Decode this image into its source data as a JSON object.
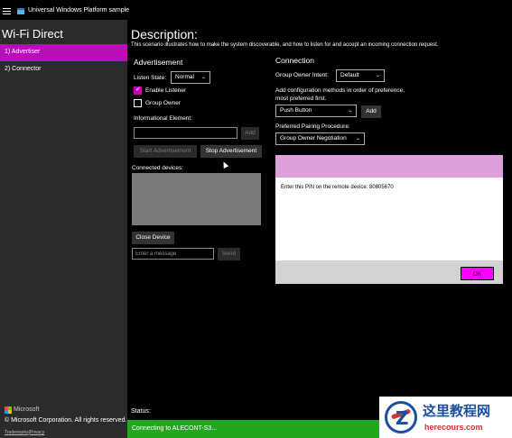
{
  "window": {
    "title": "Universal Windows Platform sample"
  },
  "sidebar": {
    "header": "Wi-Fi Direct",
    "items": [
      {
        "label": "1) Advertiser",
        "selected": true
      },
      {
        "label": "2) Connector",
        "selected": false
      }
    ],
    "brand": "Microsoft",
    "copyright": "© Microsoft Corporation. All rights reserved.",
    "legal": {
      "trademarks": "Trademarks",
      "separator": "|",
      "privacy": "Privacy"
    }
  },
  "description": {
    "title": "Description:",
    "text": "This scenario illustrates how to make the system discoverable, and how to listen for and accept an incoming connection request."
  },
  "advertisement": {
    "title": "Advertisement",
    "listen_state_label": "Listen State:",
    "listen_state_value": "Normal",
    "enable_listener_label": "Enable Listener",
    "enable_listener_checked": true,
    "group_owner_label": "Group Owner",
    "group_owner_checked": false,
    "info_element_label": "Informational Element:",
    "info_element_value": "",
    "add_label": "Add",
    "start_label": "Start Advertisement",
    "stop_label": "Stop Advertisement",
    "connected_devices_label": "Connected devices:",
    "close_device_label": "Close Device",
    "message_placeholder": "Enter a message",
    "send_label": "Send"
  },
  "connection": {
    "title": "Connection",
    "intent_label": "Group Owner Intent:",
    "intent_value": "Default",
    "config_label_line1": "Add configuration methods in order of preference,",
    "config_label_line2": "most preferred first.",
    "config_method_value": "Push Button",
    "add_label": "Add",
    "pairing_label": "Preferred Pairing Procedure:",
    "pairing_value": "Group Owner Negotiation"
  },
  "dialog": {
    "message": "Enter this PIN on the remote device: 80805670",
    "ok_label": "OK"
  },
  "status": {
    "label": "Status:",
    "message": "Connecting to ALECONT-S3..."
  },
  "watermark": {
    "logo_letter": "Z",
    "title": "这里教程网",
    "url": "herecours.com"
  },
  "colors": {
    "accent": "#b70eb7",
    "sidebar_bg": "#2b2b2b",
    "status_green": "#22a81f",
    "dialog_header": "#dda0dd",
    "ok_button": "#ff00ff"
  }
}
